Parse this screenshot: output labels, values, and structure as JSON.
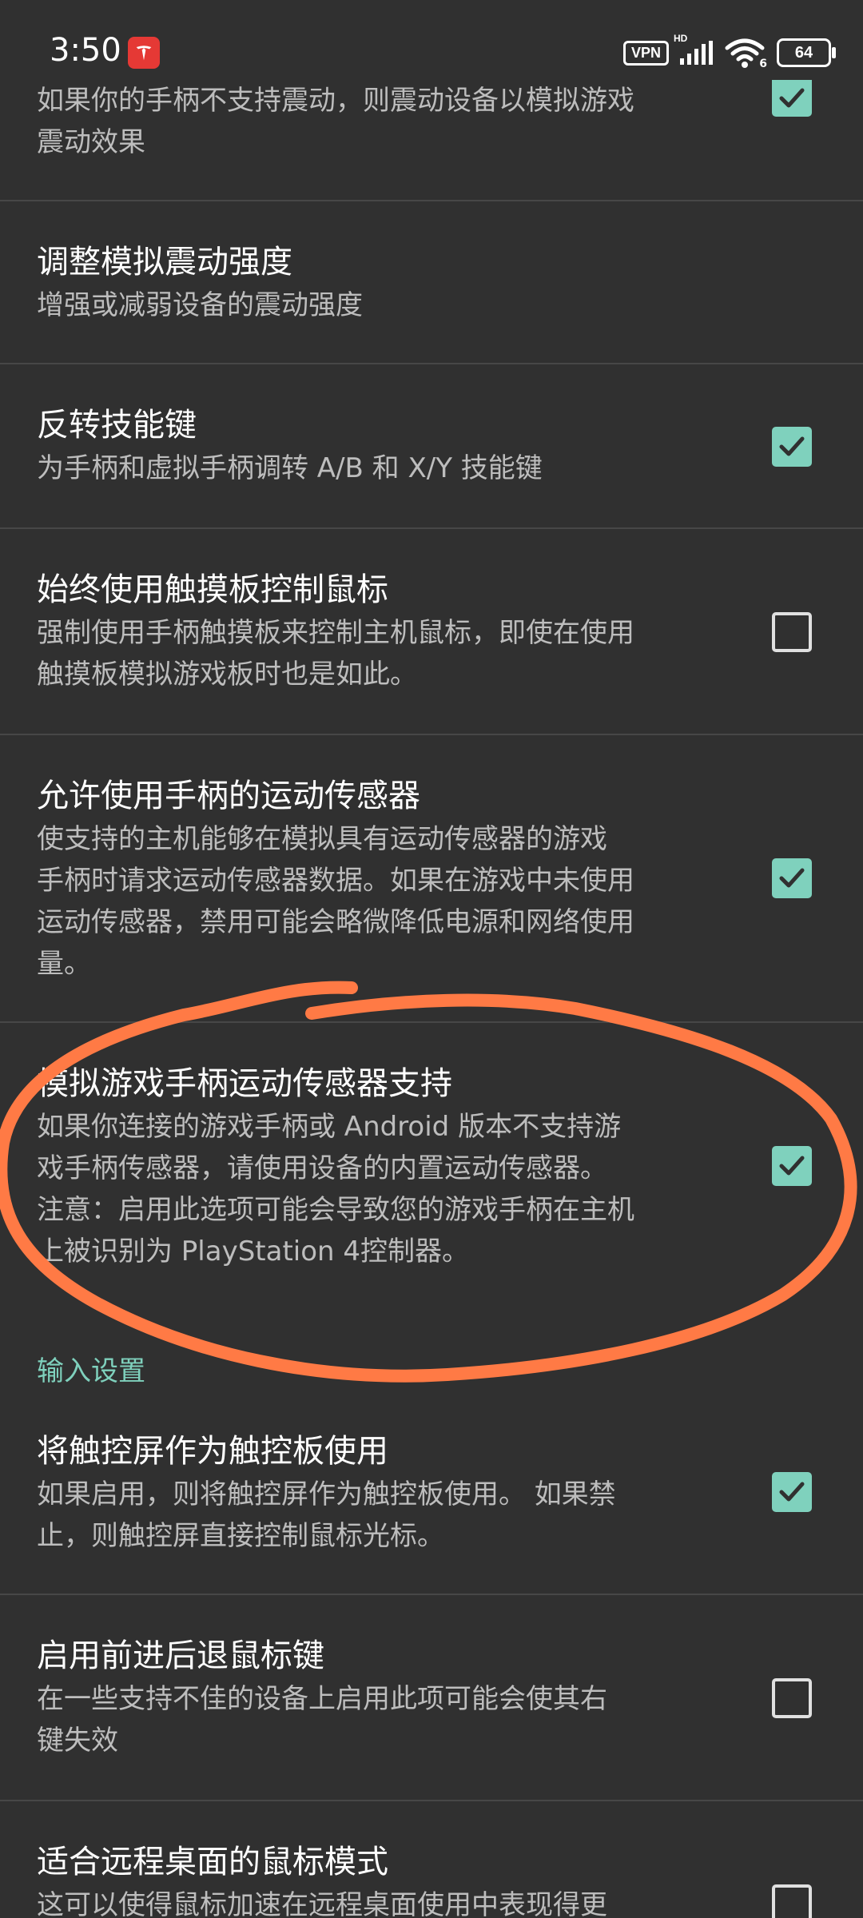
{
  "status_bar": {
    "time": "3:50",
    "vpn_label": "VPN",
    "network_label": "HD",
    "wifi_label": "6",
    "battery_level": "64",
    "app_badge_icon": "tesla-icon"
  },
  "preferences": [
    {
      "summary": "如果你的手柄不支持震动，则震动设备以模拟游戏\n震动效果",
      "checked": true
    },
    {
      "title": "调整模拟震动强度",
      "summary": "增强或减弱设备的震动强度"
    },
    {
      "title": "反转技能键",
      "summary": "为手柄和虚拟手柄调转 A/B 和 X/Y 技能键",
      "checked": true
    },
    {
      "title": "始终使用触摸板控制鼠标",
      "summary": "强制使用手柄触摸板来控制主机鼠标，即使在使用\n触摸板模拟游戏板时也是如此。",
      "checked": false
    },
    {
      "title": "允许使用手柄的运动传感器",
      "summary": "使支持的主机能够在模拟具有运动传感器的游戏\n手柄时请求运动传感器数据。如果在游戏中未使用\n运动传感器，禁用可能会略微降低电源和网络使用\n量。",
      "checked": true
    },
    {
      "title": "模拟游戏手柄运动传感器支持",
      "summary": "如果你连接的游戏手柄或 Android 版本不支持游\n戏手柄传感器，请使用设备的内置运动传感器。\n注意：启用此选项可能会导致您的游戏手柄在主机\n上被识别为 PlayStation 4控制器。",
      "checked": true
    },
    {
      "title": "将触控屏作为触控板使用",
      "summary": "如果启用，则将触控屏作为触控板使用。 如果禁\n止，则触控屏直接控制鼠标光标。",
      "checked": true
    },
    {
      "title": "启用前进后退鼠标键",
      "summary": "在一些支持不佳的设备上启用此项可能会使其右\n键失效",
      "checked": false
    },
    {
      "title": "适合远程桌面的鼠标模式",
      "summary": "这可以使得鼠标加速在远程桌面使用中表现得更",
      "checked": false
    }
  ],
  "category_input": "输入设置",
  "colors": {
    "background": "#303030",
    "accent": "#7fd1bd",
    "divider": "#474747",
    "annotation": "#ff7a45"
  }
}
